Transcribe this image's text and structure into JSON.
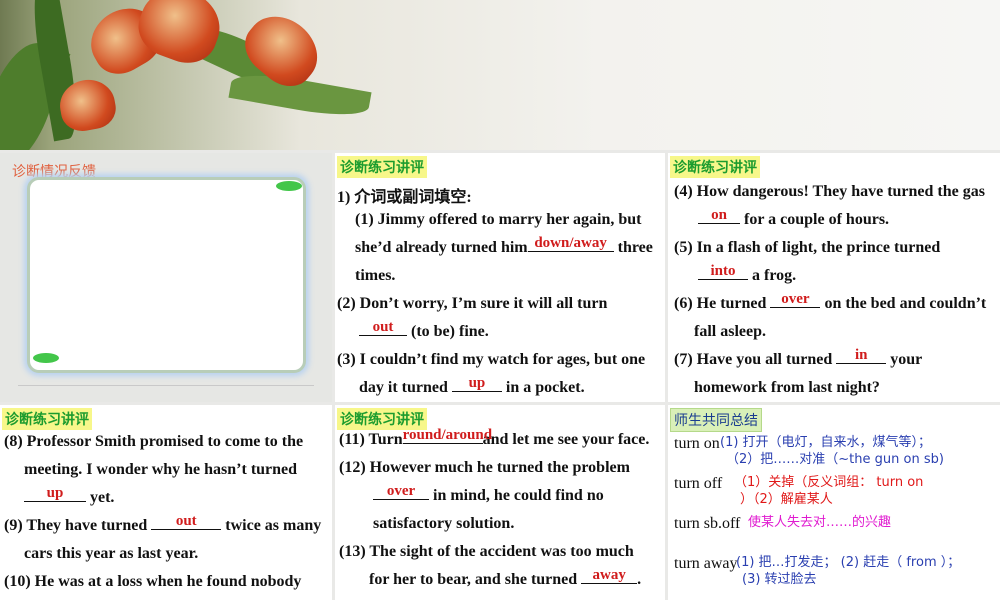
{
  "feedback_panel": {
    "title": "诊断情况反馈"
  },
  "panel2": {
    "tag": "诊断练习讲评",
    "lines": [
      {
        "parts": [
          {
            "t": "1) 介词或副词填空:"
          }
        ]
      },
      {
        "parts": [
          {
            "t": "(1) Jimmy offered to marry her again, but"
          }
        ]
      },
      {
        "parts": [
          {
            "t": "she’d already turned him"
          },
          {
            "a": "down/away",
            "w": 86
          },
          {
            "t": " three"
          }
        ]
      },
      {
        "parts": [
          {
            "t": "times."
          }
        ]
      },
      {
        "parts": [
          {
            "t": "(2) Don’t worry, I’m sure it will all turn"
          }
        ]
      },
      {
        "parts": [
          {
            "a": "out",
            "w": 48
          },
          {
            "t": " (to be) fine."
          }
        ]
      },
      {
        "parts": [
          {
            "t": "(3) I couldn’t find my watch for ages, but one"
          }
        ]
      },
      {
        "parts": [
          {
            "t": "day it turned "
          },
          {
            "a": "up",
            "w": 50
          },
          {
            "t": " in a pocket."
          }
        ]
      }
    ]
  },
  "panel3": {
    "tag": "诊断练习讲评",
    "lines": [
      {
        "parts": [
          {
            "t": "(4) How dangerous! They have turned the gas"
          }
        ]
      },
      {
        "parts": [
          {
            "a": "on",
            "w": 42
          },
          {
            "t": " for a couple of hours."
          }
        ]
      },
      {
        "parts": [
          {
            "t": "(5) In a flash of light, the prince turned"
          }
        ]
      },
      {
        "parts": [
          {
            "a": "into",
            "w": 50
          },
          {
            "t": " a frog."
          }
        ]
      },
      {
        "parts": [
          {
            "t": "(6) He turned "
          },
          {
            "a": "over",
            "w": 50
          },
          {
            "t": " on the bed and couldn’t"
          }
        ]
      },
      {
        "parts": [
          {
            "t": "fall asleep."
          }
        ]
      },
      {
        "parts": [
          {
            "t": "(7) Have you all turned "
          },
          {
            "a": "in",
            "w": 50
          },
          {
            "t": " your"
          }
        ]
      },
      {
        "parts": [
          {
            "t": "homework from last night?"
          }
        ]
      }
    ]
  },
  "panel4": {
    "tag": "诊断练习讲评",
    "lines": [
      {
        "parts": [
          {
            "t": "(8) Professor Smith promised to come to the"
          }
        ]
      },
      {
        "parts": [
          {
            "t": "meeting. I wonder why he hasn’t turned"
          }
        ]
      },
      {
        "parts": [
          {
            "a": "up",
            "w": 62
          },
          {
            "t": " yet."
          }
        ]
      },
      {
        "parts": [
          {
            "t": "(9) They have turned "
          },
          {
            "a": "out",
            "w": 70
          },
          {
            "t": " twice as many"
          }
        ]
      },
      {
        "parts": [
          {
            "t": "cars this year as last year."
          }
        ]
      },
      {
        "parts": [
          {
            "t": "(10) He was at a loss when he found nobody"
          }
        ]
      }
    ]
  },
  "panel5": {
    "tag": "诊断练习讲评",
    "lines": [
      {
        "parts": [
          {
            "t": "(11) Turn"
          },
          {
            "a": "round/around",
            "w": 80
          },
          {
            "t": "and let me see your face."
          }
        ]
      },
      {
        "parts": [
          {
            "t": "(12) However much he turned the problem"
          }
        ]
      },
      {
        "parts": [
          {
            "a": "over",
            "w": 56
          },
          {
            "t": " in mind, he could find no"
          }
        ]
      },
      {
        "parts": [
          {
            "t": "satisfactory solution."
          }
        ]
      },
      {
        "parts": [
          {
            "t": "(13) The sight of the accident was too much"
          }
        ]
      },
      {
        "parts": [
          {
            "t": "for her to bear, and she turned "
          },
          {
            "a": "away",
            "w": 56
          },
          {
            "t": "."
          }
        ]
      }
    ]
  },
  "panel6": {
    "tag": "师生共同总结",
    "entries": [
      {
        "term": "turn on",
        "def1": "(1) 打开（电灯，自来水，煤气等）；",
        "def2": "（2）把……对准（~the gun on sb)",
        "color": "#2a3fb0"
      },
      {
        "term": "turn off",
        "def1": "（1）关掉（反义词组：  turn on",
        "def2": "）（2）解雇某人",
        "color": "#e01818"
      },
      {
        "term": "turn sb.off",
        "def1": "使某人失去对……的兴趣",
        "def2": "",
        "color": "#e01ad0"
      },
      {
        "term": "turn away",
        "def1": "(1) 把…打发走； (2) 赶走（ from ）；",
        "def2": "(3) 转过脸去",
        "color": "#2a3fb0"
      }
    ]
  }
}
